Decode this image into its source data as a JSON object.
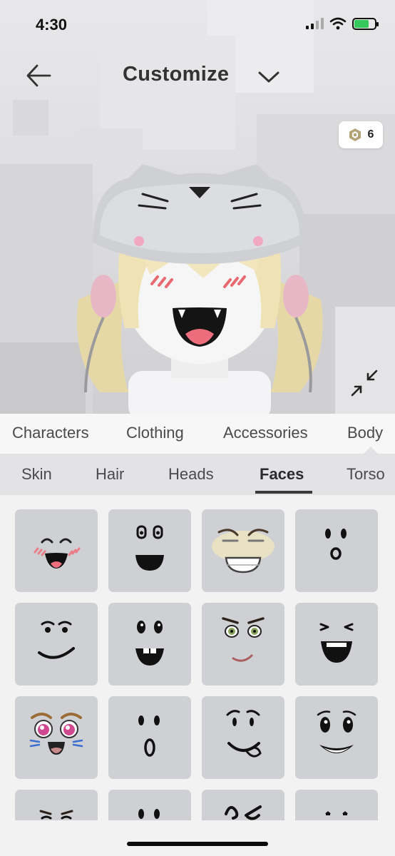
{
  "status_bar": {
    "time": "4:30",
    "battery_level": 0.7,
    "icons": [
      "signal-icon",
      "wifi-icon",
      "battery-charging-icon"
    ]
  },
  "header": {
    "title": "Customize",
    "back_icon": "arrow-left-icon",
    "menu_icon": "chevron-down-icon"
  },
  "currency": {
    "icon": "robux-icon",
    "amount": "6"
  },
  "avatar_controls": {
    "collapse_icon": "collapse-arrows-icon"
  },
  "category_tabs": [
    {
      "label": "Characters"
    },
    {
      "label": "Clothing"
    },
    {
      "label": "Accessories"
    },
    {
      "label": "Body"
    }
  ],
  "sub_tabs": [
    {
      "label": "Skin"
    },
    {
      "label": "Hair"
    },
    {
      "label": "Heads"
    },
    {
      "label": "Faces",
      "active": true
    },
    {
      "label": "Torso"
    }
  ],
  "faces": [
    "blush-smile-face",
    "open-mouth-face",
    "grin-face",
    "surprised-face",
    "smirk-face",
    "toothy-face",
    "green-eyes-face",
    "laughing-face",
    "anime-cat-face",
    "o-mouth-face",
    "tongue-face",
    "big-smile-face",
    "angry-brows-face",
    "dots-face",
    "squiggle-face",
    "small-eyes-face"
  ],
  "colors": {
    "tile_bg": "#cfd0d3",
    "active_tab": "#393b3d",
    "accent_green": "#34c759"
  }
}
